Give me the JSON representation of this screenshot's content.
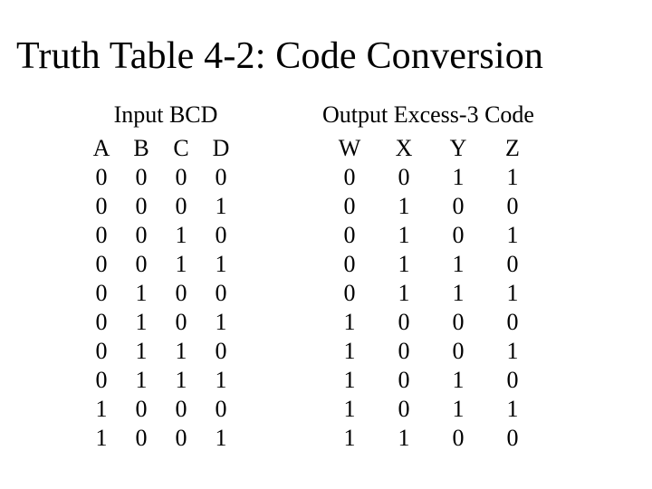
{
  "title": "Truth Table 4-2: Code Conversion",
  "input_label": "Input BCD",
  "output_label": "Output Excess-3 Code",
  "input_headers": [
    "A",
    "B",
    "C",
    "D"
  ],
  "output_headers": [
    "W",
    "X",
    "Y",
    "Z"
  ],
  "rows": [
    {
      "in": [
        "0",
        "0",
        "0",
        "0"
      ],
      "out": [
        "0",
        "0",
        "1",
        "1"
      ]
    },
    {
      "in": [
        "0",
        "0",
        "0",
        "1"
      ],
      "out": [
        "0",
        "1",
        "0",
        "0"
      ]
    },
    {
      "in": [
        "0",
        "0",
        "1",
        "0"
      ],
      "out": [
        "0",
        "1",
        "0",
        "1"
      ]
    },
    {
      "in": [
        "0",
        "0",
        "1",
        "1"
      ],
      "out": [
        "0",
        "1",
        "1",
        "0"
      ]
    },
    {
      "in": [
        "0",
        "1",
        "0",
        "0"
      ],
      "out": [
        "0",
        "1",
        "1",
        "1"
      ]
    },
    {
      "in": [
        "0",
        "1",
        "0",
        "1"
      ],
      "out": [
        "1",
        "0",
        "0",
        "0"
      ]
    },
    {
      "in": [
        "0",
        "1",
        "1",
        "0"
      ],
      "out": [
        "1",
        "0",
        "0",
        "1"
      ]
    },
    {
      "in": [
        "0",
        "1",
        "1",
        "1"
      ],
      "out": [
        "1",
        "0",
        "1",
        "0"
      ]
    },
    {
      "in": [
        "1",
        "0",
        "0",
        "0"
      ],
      "out": [
        "1",
        "0",
        "1",
        "1"
      ]
    },
    {
      "in": [
        "1",
        "0",
        "0",
        "1"
      ],
      "out": [
        "1",
        "1",
        "0",
        "0"
      ]
    }
  ],
  "chart_data": {
    "type": "table",
    "title": "Truth Table 4-2: Code Conversion",
    "columns": [
      "A",
      "B",
      "C",
      "D",
      "W",
      "X",
      "Y",
      "Z"
    ],
    "data": [
      [
        0,
        0,
        0,
        0,
        0,
        0,
        1,
        1
      ],
      [
        0,
        0,
        0,
        1,
        0,
        1,
        0,
        0
      ],
      [
        0,
        0,
        1,
        0,
        0,
        1,
        0,
        1
      ],
      [
        0,
        0,
        1,
        1,
        0,
        1,
        1,
        0
      ],
      [
        0,
        1,
        0,
        0,
        0,
        1,
        1,
        1
      ],
      [
        0,
        1,
        0,
        1,
        1,
        0,
        0,
        0
      ],
      [
        0,
        1,
        1,
        0,
        1,
        0,
        0,
        1
      ],
      [
        0,
        1,
        1,
        1,
        1,
        0,
        1,
        0
      ],
      [
        1,
        0,
        0,
        0,
        1,
        0,
        1,
        1
      ],
      [
        1,
        0,
        0,
        1,
        1,
        1,
        0,
        0
      ]
    ]
  }
}
